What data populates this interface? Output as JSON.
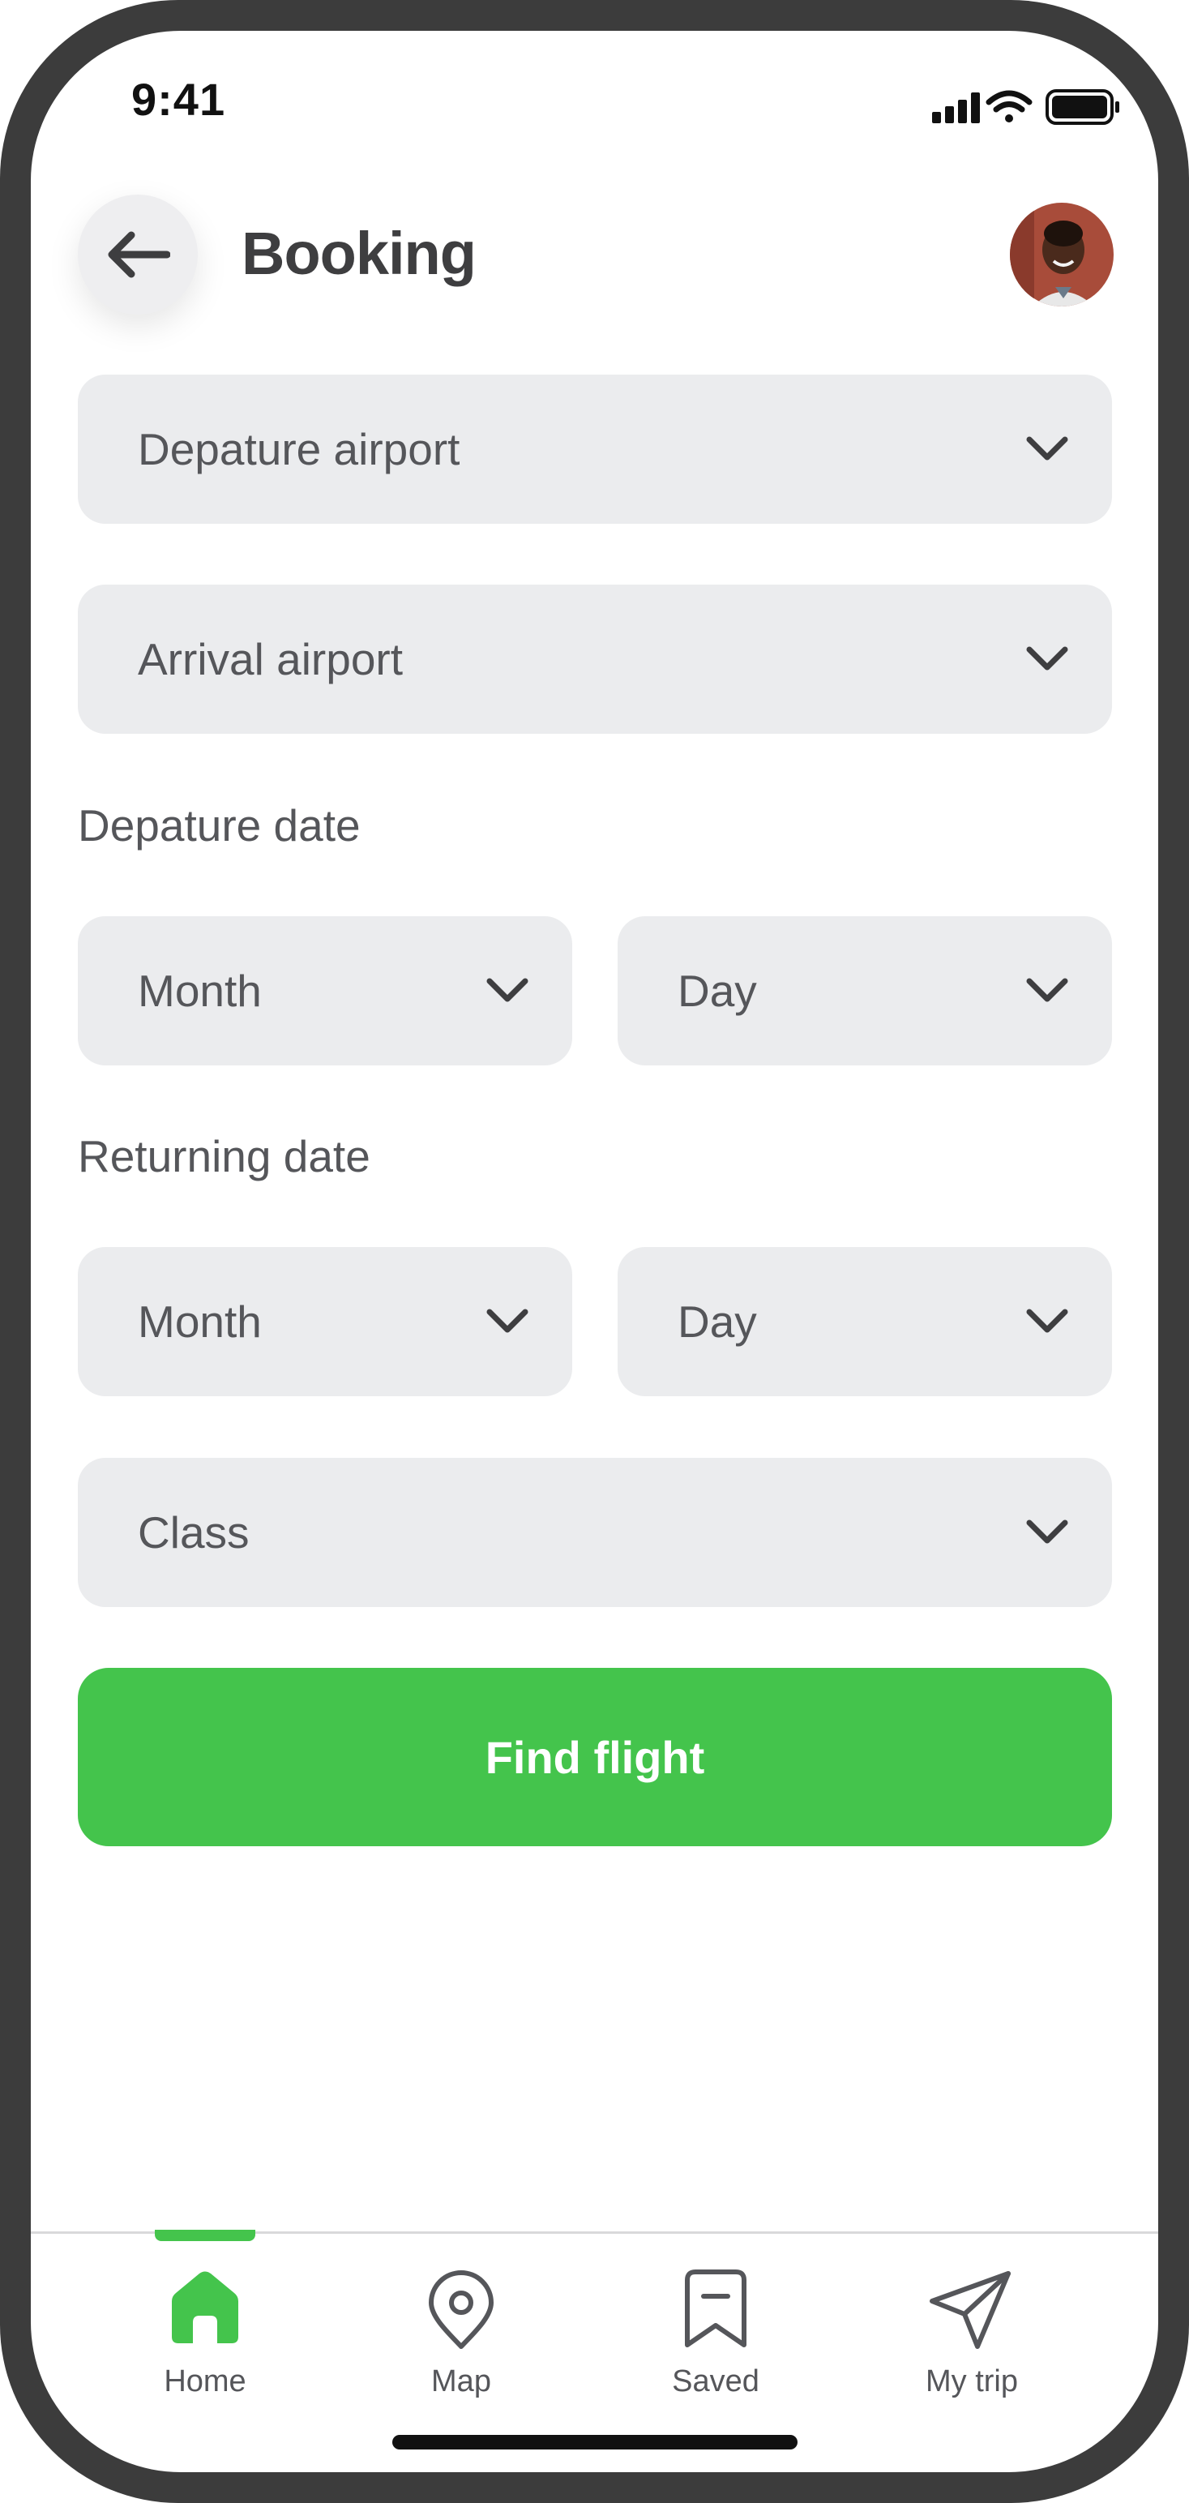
{
  "status_bar": {
    "time": "9:41",
    "icons": [
      "cellular-signal-icon",
      "wifi-icon",
      "battery-icon"
    ]
  },
  "header": {
    "back_icon": "arrow-left-icon",
    "title": "Booking",
    "avatar": "user-avatar"
  },
  "form": {
    "departure_airport": {
      "placeholder": "Depature airport"
    },
    "arrival_airport": {
      "placeholder": "Arrival airport"
    },
    "departure_date": {
      "label": "Depature date",
      "month_placeholder": "Month",
      "day_placeholder": "Day"
    },
    "returning_date": {
      "label": "Returning date",
      "month_placeholder": "Month",
      "day_placeholder": "Day"
    },
    "class": {
      "placeholder": "Class"
    },
    "submit_label": "Find flight"
  },
  "tab_bar": {
    "active_tab": "Home",
    "tabs": [
      {
        "label": "Home",
        "icon": "home-icon"
      },
      {
        "label": "Map",
        "icon": "map-pin-icon"
      },
      {
        "label": "Saved",
        "icon": "bookmark-icon"
      },
      {
        "label": "My trip",
        "icon": "paper-plane-icon"
      }
    ]
  },
  "colors": {
    "accent": "#44c44c",
    "field_background": "#ebecee",
    "text_primary": "#3e3e40",
    "text_secondary": "#55565a",
    "device_frame": "#3c3c3c"
  }
}
